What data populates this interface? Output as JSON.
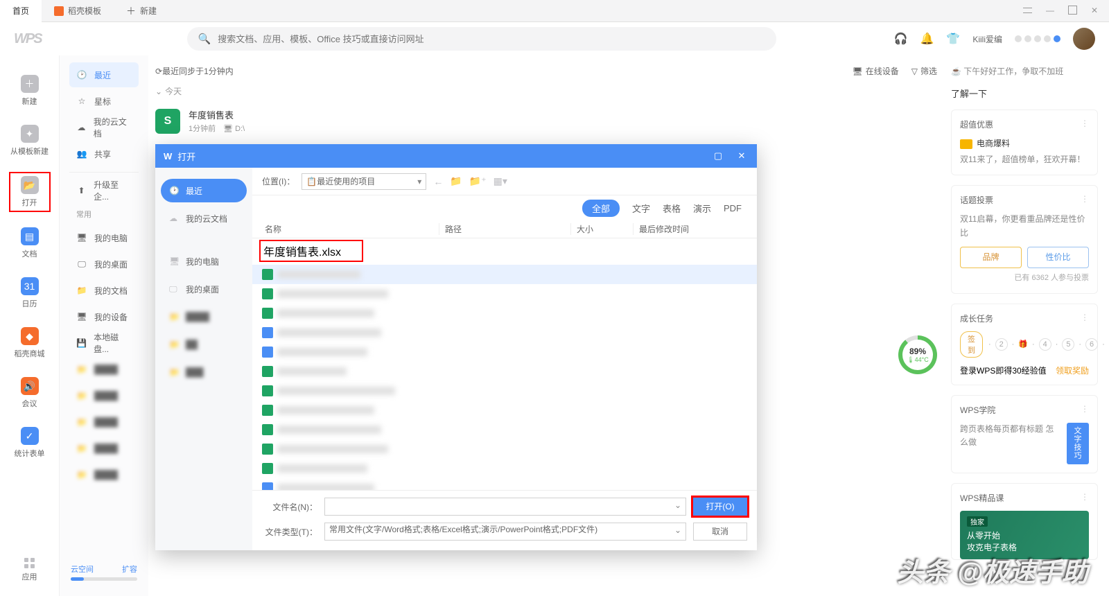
{
  "tabs": {
    "home": "首页",
    "template": "稻壳模板",
    "new": "新建"
  },
  "search": {
    "placeholder": "搜索文档、应用、模板、Office 技巧或直接访问网址"
  },
  "user": {
    "name": "Kiili爱编"
  },
  "rail": {
    "new": "新建",
    "from_template": "从模板新建",
    "open": "打开",
    "docs": "文档",
    "calendar": "日历",
    "shop": "稻壳商城",
    "meeting": "会议",
    "form": "统计表单",
    "apps": "应用"
  },
  "sidebar": {
    "recent": "最近",
    "star": "星标",
    "cloud": "我的云文档",
    "share": "共享",
    "upgrade": "升级至企...",
    "common_label": "常用",
    "mypc": "我的电脑",
    "desktop": "我的桌面",
    "mydoc": "我的文档",
    "device": "我的设备",
    "localdisk": "本地磁盘...",
    "foot_left": "云空间",
    "foot_right": "扩容"
  },
  "content": {
    "sync": "最近同步于1分钟内",
    "online_device": "在线设备",
    "filter": "筛选",
    "today": "今天",
    "file_name": "年度销售表",
    "file_meta_time": "1分钟前",
    "file_meta_path": "D:\\"
  },
  "right": {
    "tip": "☕ 下午好好工作，争取不加班",
    "learn": "了解一下",
    "promo_title": "超值优惠",
    "promo_item": "电商爆料",
    "promo_desc": "双11来了，超值榜单，狂欢开幕！",
    "vote_title": "话题投票",
    "vote_desc": "双11启幕，你更看重品牌还是性价比",
    "vote_brand": "品牌",
    "vote_price": "性价比",
    "vote_count": "已有 6362 人参与投票",
    "growth_title": "成长任务",
    "growth_chip": "签到",
    "growth_login": "登录WPS即得30经验值",
    "growth_link": "领取奖励",
    "academy_title": "WPS学院",
    "academy_desc": "跨页表格每页都有标题 怎么做",
    "academy_tag": "文字\n技巧",
    "course_title": "WPS精品课",
    "course_line1": "从零开始",
    "course_line2": "攻克电子表格"
  },
  "ring": {
    "percent": "89%",
    "temp": "44°C"
  },
  "dialog": {
    "title": "打开",
    "side_recent": "最近",
    "side_cloud": "我的云文档",
    "side_pc": "我的电脑",
    "side_desktop": "我的桌面",
    "loc_label": "位置(I)：",
    "loc_value": "最近使用的项目",
    "filter_all": "全部",
    "filter_text": "文字",
    "filter_sheet": "表格",
    "filter_slide": "演示",
    "filter_pdf": "PDF",
    "col_name": "名称",
    "col_path": "路径",
    "col_size": "大小",
    "col_date": "最后修改时间",
    "first_file": "年度销售表.xlsx",
    "filename_label": "文件名(N)：",
    "filetype_label": "文件类型(T)：",
    "filetype_value": "常用文件(文字/Word格式;表格/Excel格式;演示/PowerPoint格式;PDF文件)",
    "open_btn": "打开(O)",
    "cancel_btn": "取消"
  },
  "watermark": "头条 @极速手助"
}
